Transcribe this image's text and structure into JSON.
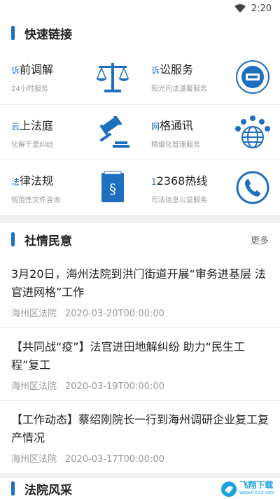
{
  "status_bar": {
    "time": "2:20"
  },
  "quick_links": {
    "title": "快速链接",
    "items": [
      {
        "lead": "诉",
        "name": "前调解",
        "sub": "24小时服务",
        "icon": "scales-icon"
      },
      {
        "lead": "诉",
        "name": "讼服务",
        "sub": "阳光司法温馨服务",
        "icon": "court-seal-icon"
      },
      {
        "lead": "云",
        "name": "上法庭",
        "sub": "化解千里纠纷",
        "icon": "gavel-icon"
      },
      {
        "lead": "网",
        "name": "格通讯",
        "sub": "精细化管理服务",
        "icon": "globe-people-icon"
      },
      {
        "lead": "法",
        "name": "律法规",
        "sub": "规范性文件咨询",
        "icon": "law-book-icon"
      },
      {
        "lead": "1",
        "name": "2368热线",
        "sub": "司法信息公益服务",
        "icon": "phone-icon"
      }
    ]
  },
  "social": {
    "title": "社情民意",
    "more": "更多",
    "news": [
      {
        "headline": "3月20日，海州法院到洪门街道开展“审务进基层 法官进网格”工作",
        "source": "海州区法院",
        "date": "2020-03-20T00:00:00"
      },
      {
        "headline": "【共同战“疫”】法官进田地解纠纷 助力“民生工程”复工",
        "source": "海州区法院",
        "date": "2020-03-19T00:00:00"
      },
      {
        "headline": "【工作动态】蔡绍刚院长一行到海州调研企业复工复产情况",
        "source": "海州区法院",
        "date": "2020-03-17T00:00:00"
      }
    ]
  },
  "court_style": {
    "title": "法院风采"
  },
  "watermark": {
    "text": "飞翔下载",
    "url_text": "www.FXXZ.com"
  },
  "colors": {
    "accent": "#1f6fbf"
  }
}
